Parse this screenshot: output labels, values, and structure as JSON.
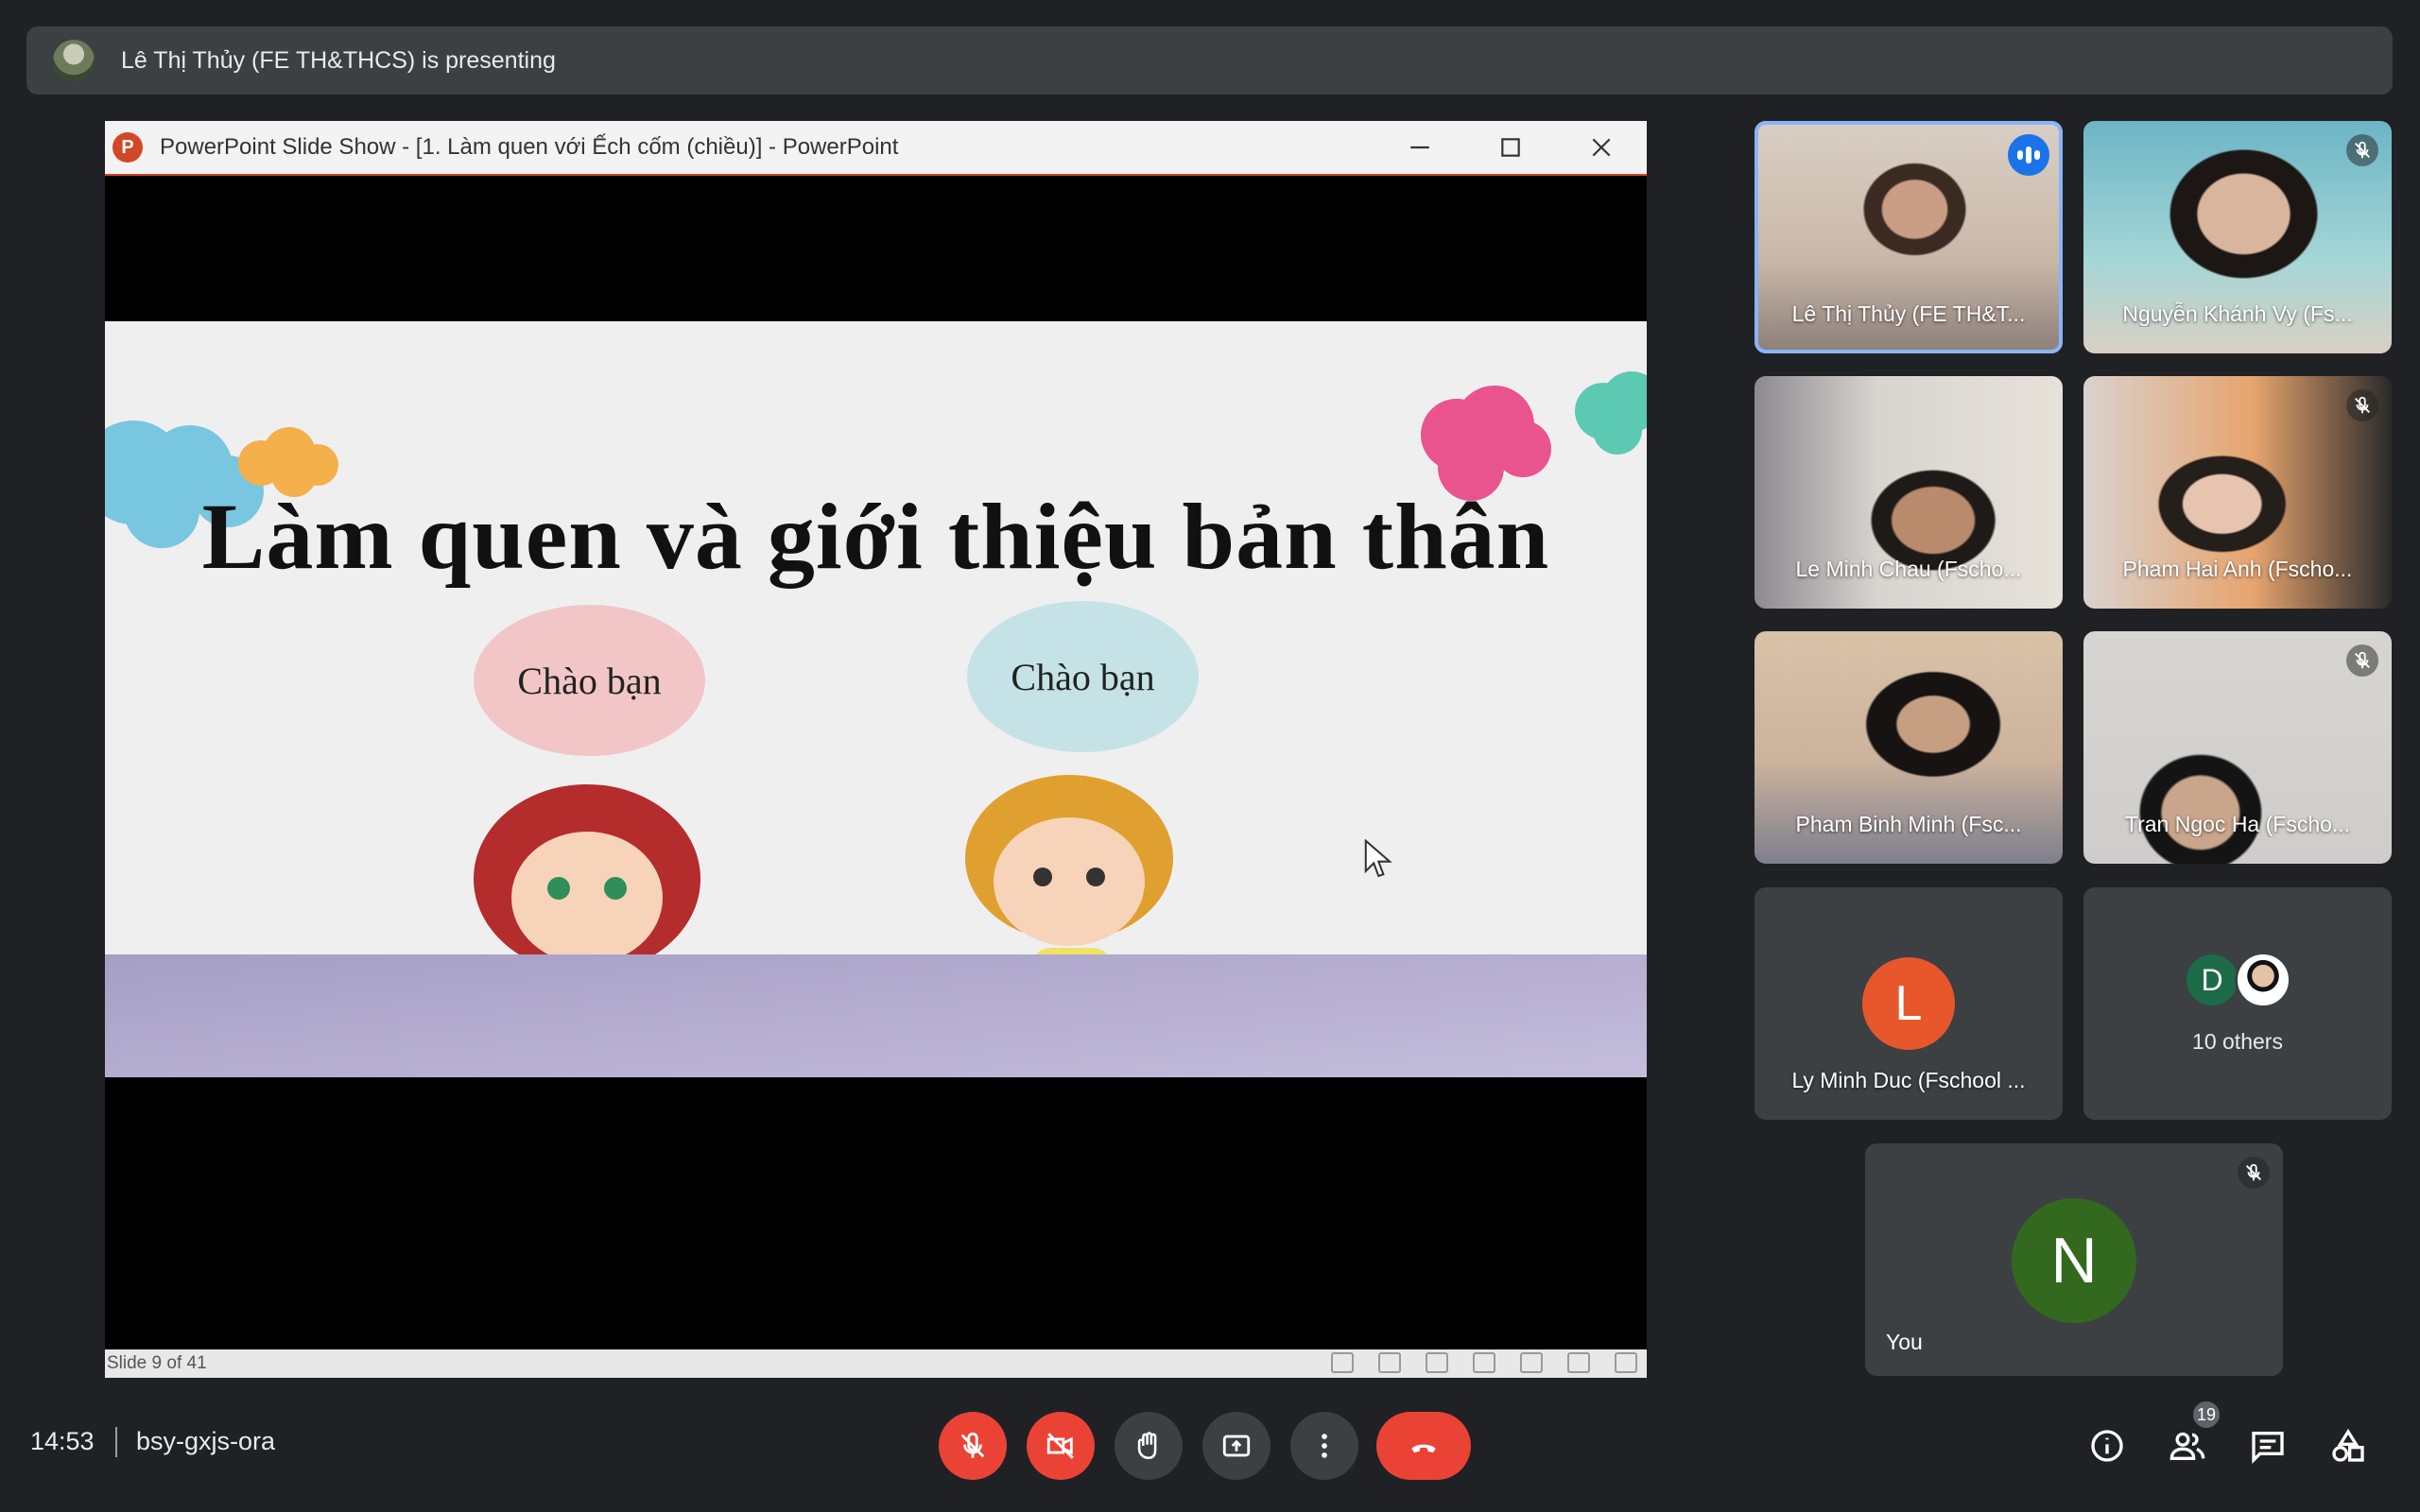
{
  "banner": {
    "text": "Lê Thị Thủy (FE TH&THCS) is presenting"
  },
  "ppt": {
    "window_title": "PowerPoint Slide Show - [1. Làm quen với Ếch cốm (chiều)] - PowerPoint",
    "logo_letter": "P",
    "slide_title": "Làm quen và giới thiệu bản thân",
    "bubble_left": "Chào bạn",
    "bubble_right": "Chào bạn",
    "status": "Slide 9 of 41"
  },
  "participants": [
    {
      "name": "Lê Thị Thủy (FE TH&T...",
      "speaking": true
    },
    {
      "name": "Nguyễn Khánh Vy (Fs...",
      "muted": true
    },
    {
      "name": "Le Minh Chau (Fscho...",
      "muted": false
    },
    {
      "name": "Pham Hai Anh (Fscho...",
      "muted": true
    },
    {
      "name": "Pham Binh Minh (Fsc...",
      "muted": false
    },
    {
      "name": "Tran Ngoc Ha (Fscho...",
      "muted": true
    },
    {
      "name": "Ly Minh Duc (Fschool ...",
      "initial": "L",
      "color": "#e8572c"
    }
  ],
  "others": {
    "initial": "D",
    "text": "10 others"
  },
  "self": {
    "initial": "N",
    "name": "You",
    "muted": true
  },
  "footer": {
    "time": "14:53",
    "meeting_code": "bsy-gxjs-ora",
    "participant_count": "19"
  },
  "icons": [
    "mic-off-icon",
    "camera-off-icon",
    "hand-icon",
    "present-icon",
    "more-icon",
    "hangup-icon",
    "info-icon",
    "people-icon",
    "chat-icon",
    "activities-icon"
  ],
  "colors": {
    "bg": "#202124",
    "tile": "#3c4043",
    "danger": "#ea4335",
    "active_outline": "#8ab4f8"
  }
}
